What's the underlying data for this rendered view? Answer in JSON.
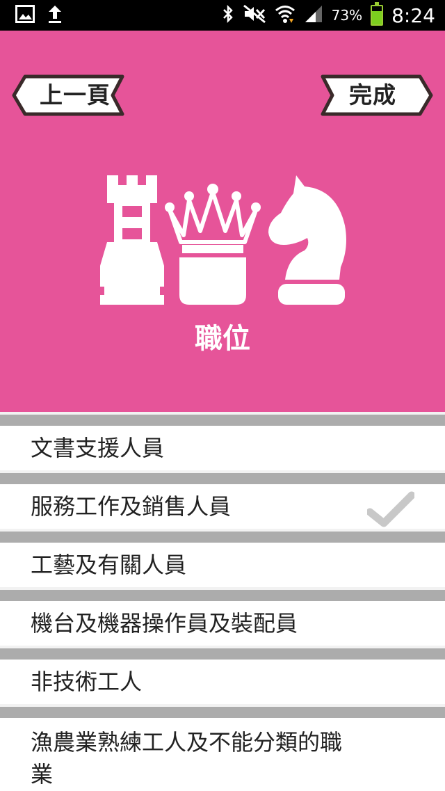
{
  "status_bar": {
    "battery_percent": "73%",
    "battery_level": 0.73,
    "time": "8:24",
    "icons": [
      "image-icon",
      "upload-icon",
      "bluetooth-icon",
      "mute-icon",
      "wifi-icon",
      "signal-icon",
      "battery-icon"
    ]
  },
  "header": {
    "back_label": "上一頁",
    "done_label": "完成",
    "title": "職位",
    "background_color": "#e65499",
    "icons": [
      "rook-icon",
      "crown-icon",
      "knight-icon"
    ]
  },
  "list": {
    "items": [
      {
        "label": "文書支援人員",
        "selected": false
      },
      {
        "label": "服務工作及銷售人員",
        "selected": true
      },
      {
        "label": "工藝及有關人員",
        "selected": false
      },
      {
        "label": "機台及機器操作員及裝配員",
        "selected": false
      },
      {
        "label": "非技術工人",
        "selected": false
      },
      {
        "label": "漁農業熟練工人及不能分類的職業",
        "selected": false
      }
    ],
    "check_icon": "checkmark-icon"
  }
}
